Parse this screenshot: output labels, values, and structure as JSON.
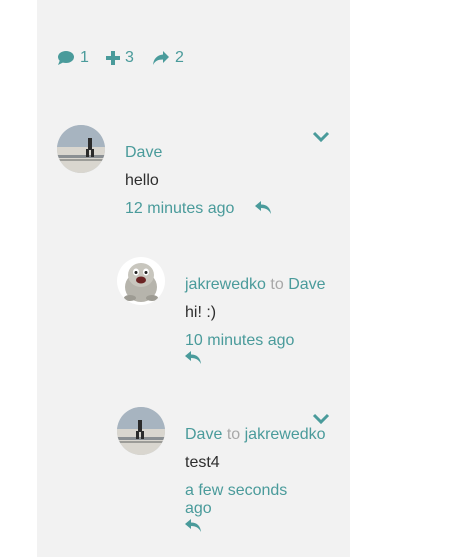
{
  "stats": {
    "comments_count": "1",
    "upvotes_count": "3",
    "shares_count": "2"
  },
  "icons": {
    "comment": "comment-icon",
    "plus": "plus-icon",
    "share": "share-icon",
    "reply": "reply-icon",
    "collapse": "chevron-down-icon"
  },
  "colors": {
    "accent": "#4a9b9b",
    "muted": "#a8a8a8",
    "text": "#2e2e2e",
    "panel": "#f2f2f2"
  },
  "comments": [
    {
      "author": "Dave",
      "text": "hello",
      "time": "12 minutes ago"
    },
    {
      "author": "jakrewedko",
      "to_word": "to",
      "reply_to": "Dave",
      "text": "hi! :)",
      "time": "10 minutes ago"
    },
    {
      "author": "Dave",
      "to_word": "to",
      "reply_to": "jakrewedko",
      "text": "test4",
      "time_line1": "a few seconds",
      "time_line2": "ago"
    }
  ]
}
